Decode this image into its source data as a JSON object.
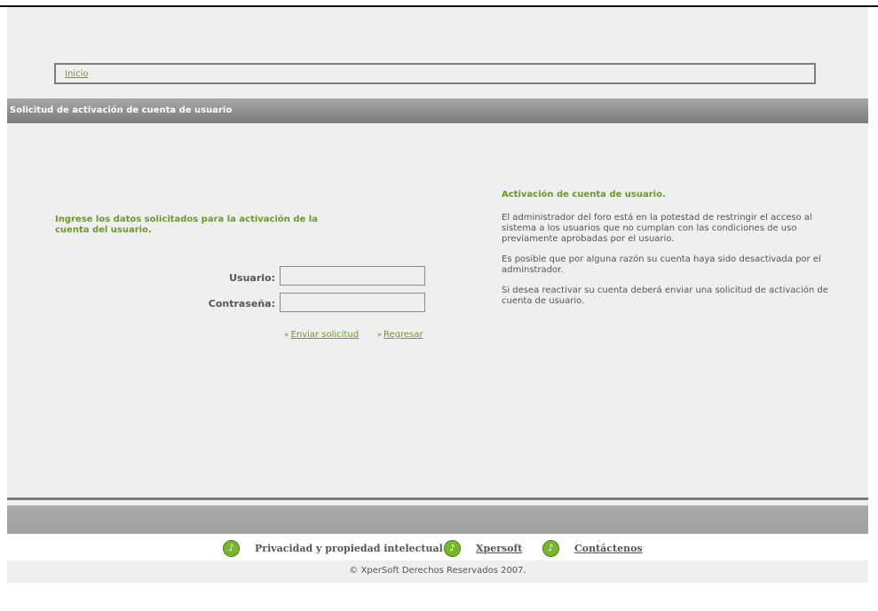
{
  "breadcrumb": {
    "home_label": "Inicio"
  },
  "section": {
    "title": "Solicitud de activación de cuenta de usuario"
  },
  "form": {
    "heading": "Ingrese los datos solicitados para la activación de la cuenta del usuario.",
    "user_label": "Usuario:",
    "user_value": "",
    "password_label": "Contraseña:",
    "password_value": "",
    "send_label": "Enviar solicitud",
    "back_label": "Regresar"
  },
  "info": {
    "title": "Activación de cuenta de usuario.",
    "paragraphs": [
      "El administrador del foro está en la potestad de restringir el acceso al sistema a los usuarios que no cumplan con las condiciones de uso previamente aprobadas por el usuario.",
      "Es posible que por alguna razón su cuenta haya sido desactivada por el adminstrador.",
      "Si desea reactivar su cuenta deberá enviar una solicitud de activación de cuenta de usuario."
    ]
  },
  "footer": {
    "privacy_label": "Privacidad y propiedad intelectual",
    "company_label": "Xpersoft",
    "contact_label": "Contáctenos",
    "copyright": "© XperSoft Derechos Reservados 2007."
  },
  "colors": {
    "accent": "#6e9a1d",
    "icon": "#78b62c",
    "bar": "#8c8c8c"
  }
}
